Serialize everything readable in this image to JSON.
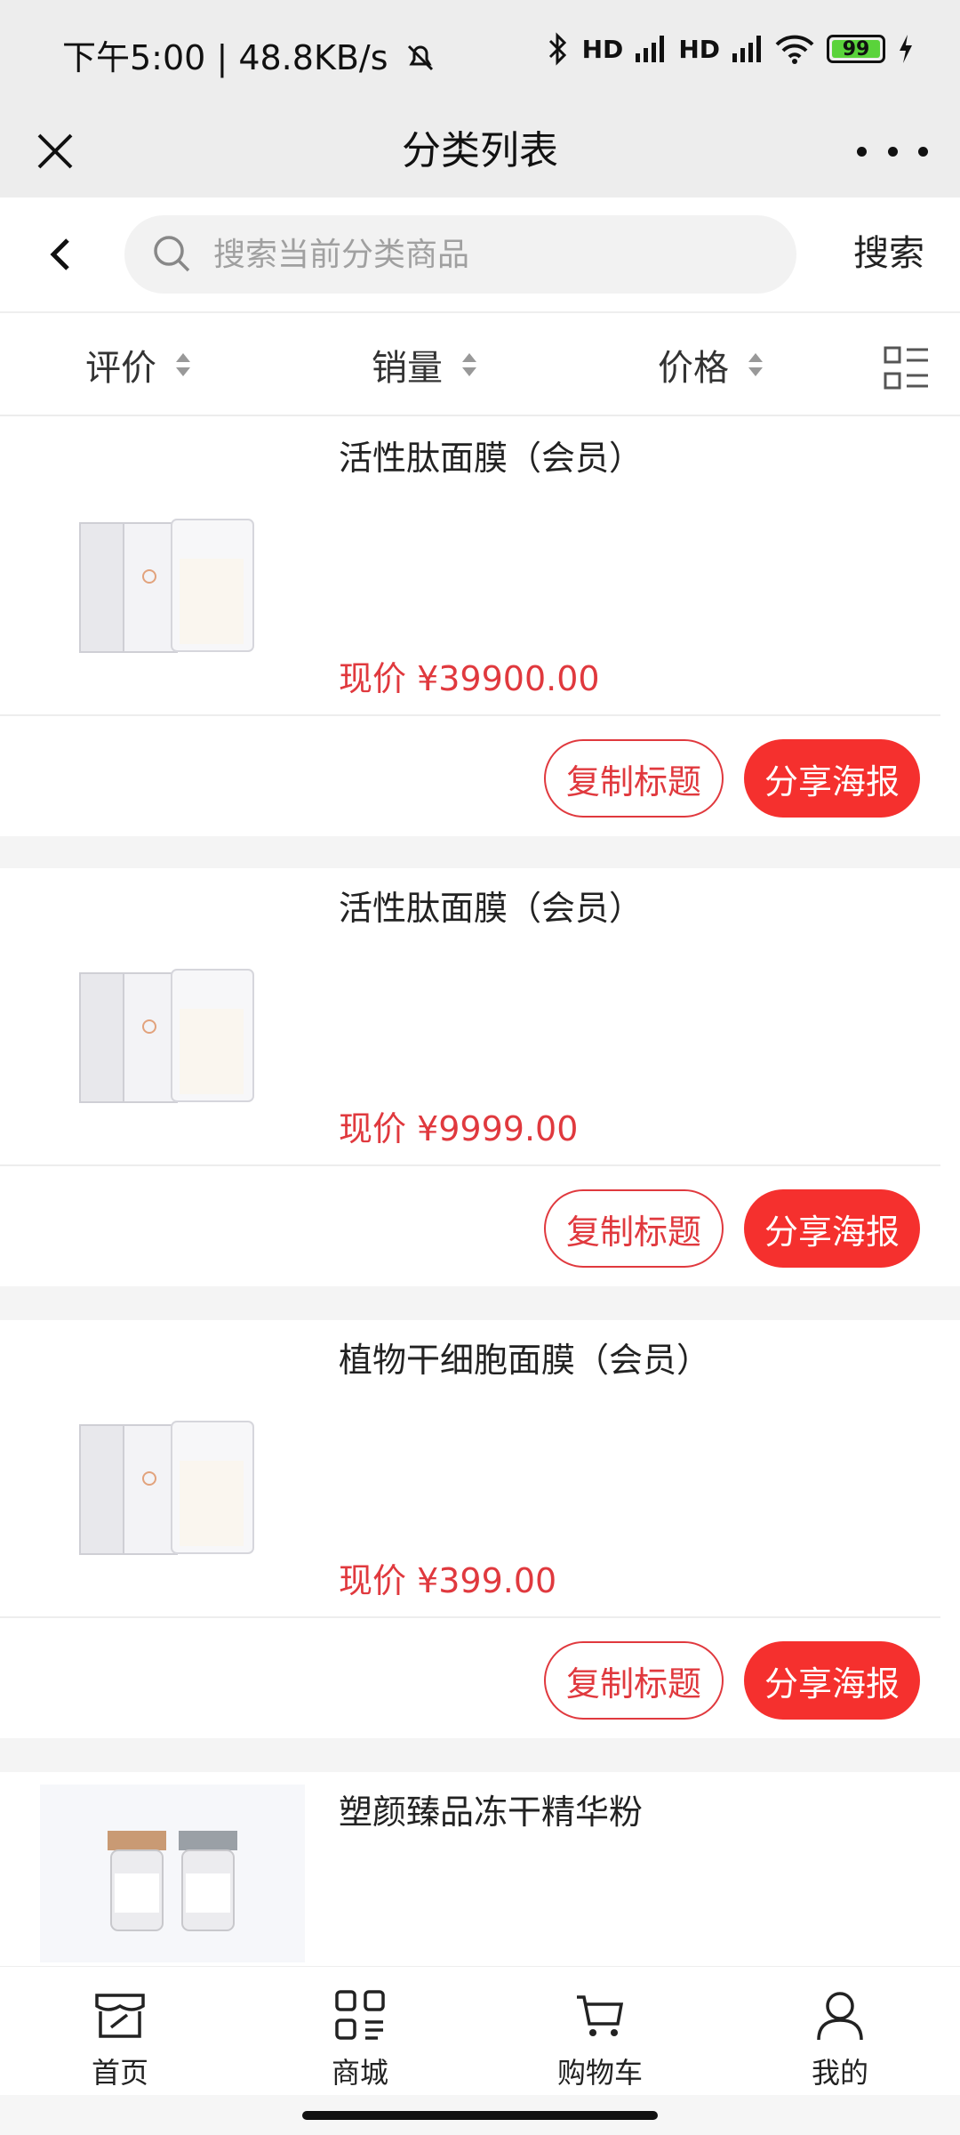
{
  "status_bar": {
    "time": "下午5:00",
    "speed": "48.8KB/s",
    "signal1": "HD",
    "signal2": "HD",
    "battery": "99"
  },
  "title_bar": {
    "title": "分类列表"
  },
  "search": {
    "placeholder": "搜索当前分类商品",
    "button": "搜索"
  },
  "sort": [
    {
      "label": "评价"
    },
    {
      "label": "销量"
    },
    {
      "label": "价格"
    }
  ],
  "products": [
    {
      "name": "活性肽面膜（会员）",
      "price": "现价 ¥39900.00",
      "copy": "复制标题",
      "share": "分享海报"
    },
    {
      "name": "活性肽面膜（会员）",
      "price": "现价 ¥9999.00",
      "copy": "复制标题",
      "share": "分享海报"
    },
    {
      "name": "植物干细胞面膜（会员）",
      "price": "现价 ¥399.00",
      "copy": "复制标题",
      "share": "分享海报"
    },
    {
      "name": "塑颜臻品冻干精华粉",
      "price": "",
      "copy": "",
      "share": ""
    }
  ],
  "tabs": [
    {
      "label": "首页",
      "icon": "home-store-icon"
    },
    {
      "label": "商城",
      "icon": "grid-menu-icon"
    },
    {
      "label": "购物车",
      "icon": "cart-icon"
    },
    {
      "label": "我的",
      "icon": "user-icon"
    }
  ],
  "colors": {
    "accent": "#f5302e",
    "price": "#e0393e",
    "bar": "#ededed"
  }
}
